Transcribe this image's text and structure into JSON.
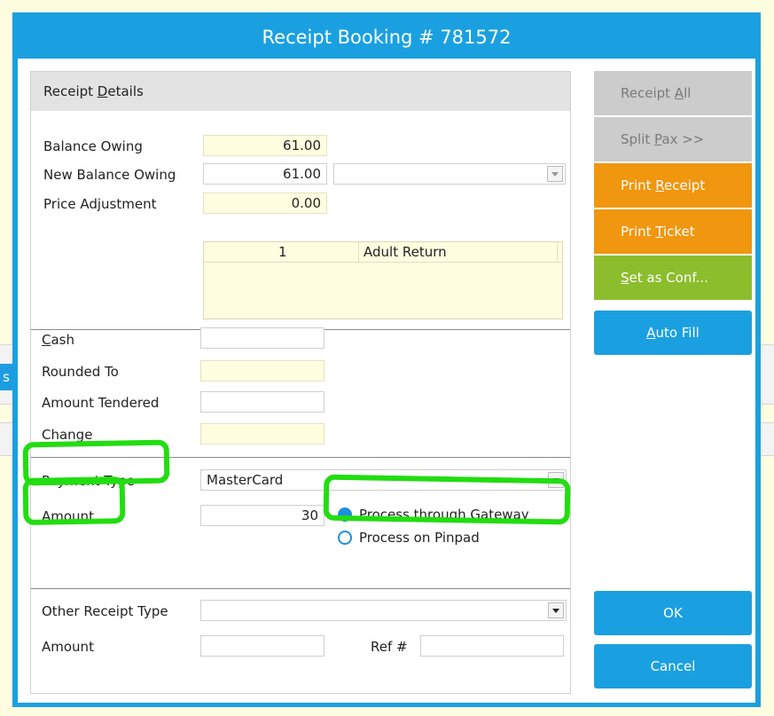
{
  "background": {
    "letter": "s"
  },
  "dialog": {
    "title": "Receipt Booking # 781572"
  },
  "receipt_details": {
    "heading_pre": "Receipt ",
    "heading_u": "D",
    "heading_post": "etails",
    "balance_owing_label": "Balance Owing",
    "balance_owing_value": "61.00",
    "new_balance_owing_label": "New Balance Owing",
    "new_balance_owing_value": "61.00",
    "new_balance_owing_select": "",
    "price_adjustment_label": "Price Adjustment",
    "price_adjustment_value": "0.00",
    "pax": [
      {
        "qty": "1",
        "type": "Adult Return"
      }
    ]
  },
  "cash_section": {
    "cash_label_u": "C",
    "cash_label_rest": "ash",
    "cash_value": "",
    "rounded_to_label": "Rounded To",
    "rounded_to_value": "",
    "amount_tendered_label": "Amount Tendered",
    "amount_tendered_value": "",
    "change_label": "Change",
    "change_value": ""
  },
  "payment": {
    "payment_type_label": "Payment Type",
    "payment_type_value": "MasterCard",
    "amount_label": "Amount",
    "amount_value": "30",
    "options": [
      {
        "label": "Process through Gateway",
        "selected": true
      },
      {
        "label": "Process on Pinpad",
        "selected": false
      }
    ]
  },
  "other": {
    "other_receipt_type_label": "Other Receipt Type",
    "other_receipt_type_value": "",
    "amount_label": "Amount",
    "amount_value": "",
    "ref_label": "Ref #",
    "ref_value": ""
  },
  "buttons": {
    "receipt_all": {
      "pre": "Receipt ",
      "u": "A",
      "post": "ll"
    },
    "split_pax": {
      "pre": "Split ",
      "u": "P",
      "post": "ax >>"
    },
    "print_receipt": {
      "pre": "Print ",
      "u": "R",
      "post": "eceipt"
    },
    "print_ticket": {
      "pre": "Print ",
      "u": "T",
      "post": "icket"
    },
    "set_as_conf": {
      "pre": "",
      "u": "S",
      "post": "et as Conf..."
    },
    "auto_fill": {
      "pre": "",
      "u": "A",
      "post": "uto Fill"
    },
    "ok": "OK",
    "cancel": "Cancel"
  },
  "colors": {
    "title_bar": "#1aa0e0",
    "page_background": "#fffde0",
    "button_orange": "#f0960f",
    "button_green": "#8cbd2c",
    "button_grey": "#cccccc",
    "highlight": "#22dd11"
  }
}
